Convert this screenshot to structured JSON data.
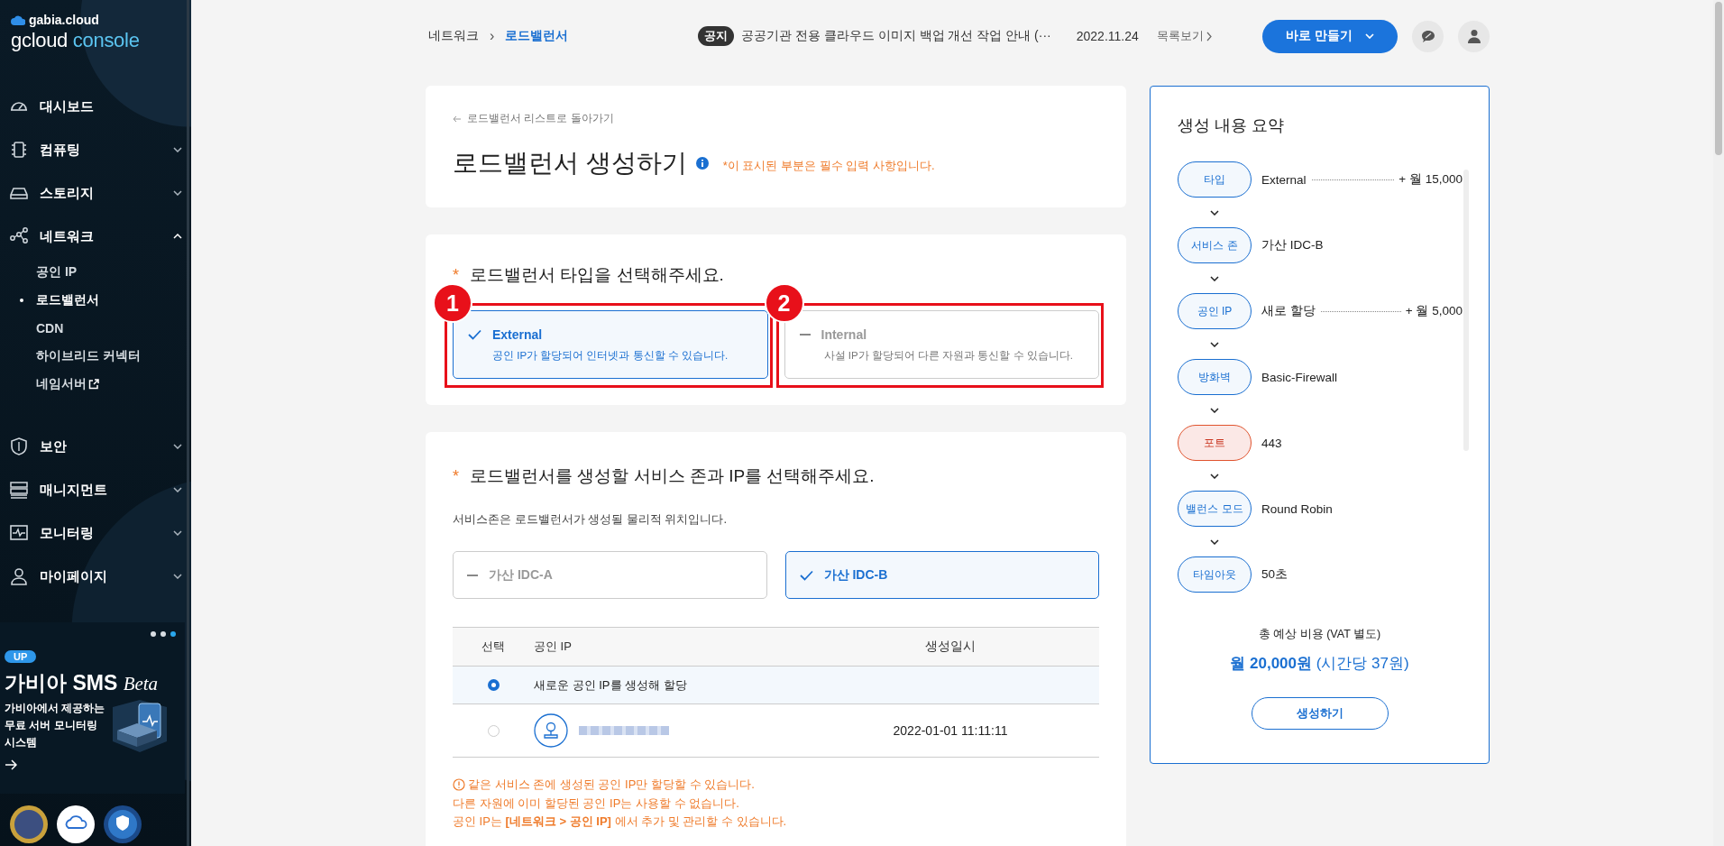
{
  "sidebar": {
    "brand": "gabia.cloud",
    "product": "gcloud",
    "product_suffix": "console",
    "nav": [
      {
        "label": "대시보드",
        "kind": "link"
      },
      {
        "label": "컴퓨팅",
        "kind": "group",
        "expanded": false
      },
      {
        "label": "스토리지",
        "kind": "group",
        "expanded": false
      },
      {
        "label": "네트워크",
        "kind": "group",
        "expanded": true,
        "children": [
          {
            "label": "공인 IP",
            "selected": false,
            "external": false
          },
          {
            "label": "로드밸런서",
            "selected": true,
            "external": false
          },
          {
            "label": "CDN",
            "selected": false,
            "external": false
          },
          {
            "label": "하이브리드 커넥터",
            "selected": false,
            "external": false
          },
          {
            "label": "네임서버",
            "selected": false,
            "external": true
          }
        ]
      },
      {
        "label": "보안",
        "kind": "group",
        "expanded": false
      },
      {
        "label": "매니지먼트",
        "kind": "group",
        "expanded": false
      },
      {
        "label": "모니터링",
        "kind": "group",
        "expanded": false
      },
      {
        "label": "마이페이지",
        "kind": "group",
        "expanded": false
      }
    ],
    "banner": {
      "badge": "UP",
      "title": "가비아 SMS",
      "title_suffix": "Beta",
      "description": "가비아에서 제공하는\n무료 서버 모니터링\n시스템",
      "slides": [
        {
          "selected": false
        },
        {
          "selected": false
        },
        {
          "selected": true
        }
      ]
    }
  },
  "header": {
    "breadcrumb": [
      {
        "label": "네트워크",
        "current": false
      },
      {
        "label": "로드밸런서",
        "current": true
      }
    ],
    "separator": "›",
    "notice": {
      "badge": "공지",
      "text": "공공기관 전용 클라우드 이미지 백업 개선 작업 안내 (···",
      "date": "2022.11.24",
      "more": "목록보기"
    },
    "create_button": "바로 만들기"
  },
  "page": {
    "back_link": "로드밸런서 리스트로 돌아가기",
    "title": "로드밸런서 생성하기",
    "required_note": "*이 표시된 부분은 필수 입력 사항입니다."
  },
  "type_section": {
    "required_mark": "*",
    "title": "로드밸런서 타입을 선택해주세요.",
    "options": [
      {
        "title": "External",
        "description": "공인 IP가 할당되어 인터넷과 통신할 수 있습니다.",
        "selected": true,
        "callout": "1"
      },
      {
        "title": "Internal",
        "description": "사설 IP가 할당되어 다른 자원과 통신할 수 있습니다.",
        "selected": false,
        "callout": "2"
      }
    ]
  },
  "zone_section": {
    "required_mark": "*",
    "title": "로드밸런서를 생성할 서비스 존과 IP를 선택해주세요.",
    "description": "서비스존은 로드밸런서가 생성될 물리적 위치입니다.",
    "zones": [
      {
        "label": "가산 IDC-A",
        "selected": false
      },
      {
        "label": "가산 IDC-B",
        "selected": true
      }
    ],
    "table": {
      "columns": [
        "선택",
        "공인 IP",
        "생성일시"
      ],
      "rows": [
        {
          "kind": "new",
          "selected": true,
          "label": "새로운 공인 IP를 생성해 할당"
        },
        {
          "kind": "existing",
          "selected": false,
          "created": "2022-01-01 11:11:11"
        }
      ]
    },
    "notes": [
      "같은 서비스 존에 생성된 공인 IP만 할당할 수 있습니다.",
      "다른 자원에 이미 할당된 공인 IP는 사용할 수 없습니다.",
      "공인 IP는 **[네트워크 > 공인 IP]** 에서 추가 및 관리할 수 있습니다."
    ]
  },
  "summary": {
    "title": "생성 내용 요약",
    "steps": [
      {
        "label": "타입",
        "value": "External",
        "cost": "+ 월 15,000",
        "invalid": false
      },
      {
        "label": "서비스 존",
        "value": "가산 IDC-B",
        "invalid": false
      },
      {
        "label": "공인 IP",
        "value": "새로 할당",
        "cost": "+ 월 5,000",
        "invalid": false
      },
      {
        "label": "방화벽",
        "value": "Basic-Firewall",
        "invalid": false
      },
      {
        "label": "포트",
        "value": "443",
        "invalid": true
      },
      {
        "label": "밸런스 모드",
        "value": "Round Robin",
        "invalid": false
      },
      {
        "label": "타임아웃",
        "value": "50초",
        "invalid": false
      }
    ],
    "total_label": "총 예상 비용 (VAT 별도)",
    "total_amount": "월 20,000원",
    "total_hourly": "(시간당 37원)",
    "create_button": "생성하기"
  }
}
